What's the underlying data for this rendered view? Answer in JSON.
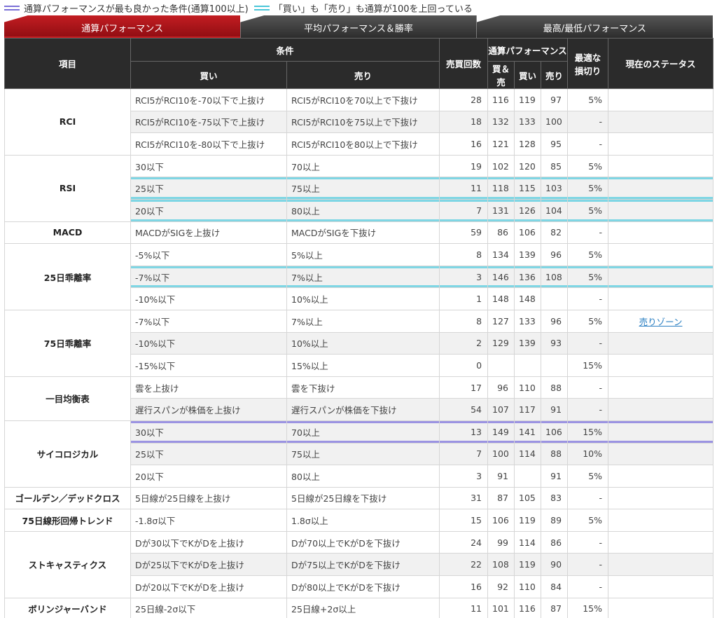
{
  "legend": {
    "purple_text": "通算パフォーマンスが最も良かった条件(通算100以上)",
    "cyan_text": "「買い」も「売り」も通算が100を上回っている"
  },
  "tabs": [
    "通算パフォーマンス",
    "平均パフォーマンス＆勝率",
    "最高/最低パフォーマンス"
  ],
  "headers": {
    "item": "項目",
    "condition": "条件",
    "buy": "買い",
    "sell": "売り",
    "trades": "売買回数",
    "perf": "通算パフォーマンス",
    "perf_both": "買＆売",
    "perf_buy": "買い",
    "perf_sell": "売り",
    "stoploss_1": "最適な",
    "stoploss_2": "損切り",
    "status": "現在のステータス"
  },
  "groups": [
    {
      "name": "RCI",
      "rows": [
        {
          "buy": "RCI5がRCI10を-70以下で上抜け",
          "sell": "RCI5がRCI10を70以上で下抜け",
          "trades": "28",
          "both": "116",
          "pbuy": "119",
          "psell": "97",
          "stop": "5%",
          "status": ""
        },
        {
          "buy": "RCI5がRCI10を-75以下で上抜け",
          "sell": "RCI5がRCI10を75以上で下抜け",
          "trades": "18",
          "both": "132",
          "pbuy": "133",
          "psell": "100",
          "stop": "-",
          "status": ""
        },
        {
          "buy": "RCI5がRCI10を-80以下で上抜け",
          "sell": "RCI5がRCI10を80以上で下抜け",
          "trades": "16",
          "both": "121",
          "pbuy": "128",
          "psell": "95",
          "stop": "-",
          "status": ""
        }
      ]
    },
    {
      "name": "RSI",
      "rows": [
        {
          "buy": "30以下",
          "sell": "70以上",
          "trades": "19",
          "both": "102",
          "pbuy": "120",
          "psell": "85",
          "stop": "5%",
          "status": ""
        },
        {
          "buy": "25以下",
          "sell": "75以上",
          "trades": "11",
          "both": "118",
          "pbuy": "115",
          "psell": "103",
          "stop": "5%",
          "status": ""
        },
        {
          "buy": "20以下",
          "sell": "80以上",
          "trades": "7",
          "both": "131",
          "pbuy": "126",
          "psell": "104",
          "stop": "5%",
          "status": ""
        }
      ]
    },
    {
      "name": "MACD",
      "rows": [
        {
          "buy": "MACDがSIGを上抜け",
          "sell": "MACDがSIGを下抜け",
          "trades": "59",
          "both": "86",
          "pbuy": "106",
          "psell": "82",
          "stop": "-",
          "status": ""
        }
      ]
    },
    {
      "name": "25日乖離率",
      "rows": [
        {
          "buy": "-5%以下",
          "sell": "5%以上",
          "trades": "8",
          "both": "134",
          "pbuy": "139",
          "psell": "96",
          "stop": "5%",
          "status": ""
        },
        {
          "buy": "-7%以下",
          "sell": "7%以上",
          "trades": "3",
          "both": "146",
          "pbuy": "136",
          "psell": "108",
          "stop": "5%",
          "status": ""
        },
        {
          "buy": "-10%以下",
          "sell": "10%以上",
          "trades": "1",
          "both": "148",
          "pbuy": "148",
          "psell": "",
          "stop": "-",
          "status": ""
        }
      ]
    },
    {
      "name": "75日乖離率",
      "rows": [
        {
          "buy": "-7%以下",
          "sell": "7%以上",
          "trades": "8",
          "both": "127",
          "pbuy": "133",
          "psell": "96",
          "stop": "5%",
          "status": "売りゾーン"
        },
        {
          "buy": "-10%以下",
          "sell": "10%以上",
          "trades": "2",
          "both": "129",
          "pbuy": "139",
          "psell": "93",
          "stop": "-",
          "status": ""
        },
        {
          "buy": "-15%以下",
          "sell": "15%以上",
          "trades": "0",
          "both": "",
          "pbuy": "",
          "psell": "",
          "stop": "15%",
          "status": ""
        }
      ]
    },
    {
      "name": "一目均衡表",
      "rows": [
        {
          "buy": "雲を上抜け",
          "sell": "雲を下抜け",
          "trades": "17",
          "both": "96",
          "pbuy": "110",
          "psell": "88",
          "stop": "-",
          "status": ""
        },
        {
          "buy": "遅行スパンが株価を上抜け",
          "sell": "遅行スパンが株価を下抜け",
          "trades": "54",
          "both": "107",
          "pbuy": "117",
          "psell": "91",
          "stop": "-",
          "status": ""
        }
      ]
    },
    {
      "name": "サイコロジカル",
      "rows": [
        {
          "buy": "30以下",
          "sell": "70以上",
          "trades": "13",
          "both": "149",
          "pbuy": "141",
          "psell": "106",
          "stop": "15%",
          "status": ""
        },
        {
          "buy": "25以下",
          "sell": "75以上",
          "trades": "7",
          "both": "100",
          "pbuy": "114",
          "psell": "88",
          "stop": "10%",
          "status": ""
        },
        {
          "buy": "20以下",
          "sell": "80以上",
          "trades": "3",
          "both": "91",
          "pbuy": "",
          "psell": "91",
          "stop": "5%",
          "status": ""
        }
      ]
    },
    {
      "name": "ゴールデン／デッドクロス",
      "rows": [
        {
          "buy": "5日線が25日線を上抜け",
          "sell": "5日線が25日線を下抜け",
          "trades": "31",
          "both": "87",
          "pbuy": "105",
          "psell": "83",
          "stop": "-",
          "status": ""
        }
      ]
    },
    {
      "name": "75日線形回帰トレンド",
      "rows": [
        {
          "buy": "-1.8σ以下",
          "sell": "1.8σ以上",
          "trades": "15",
          "both": "106",
          "pbuy": "119",
          "psell": "89",
          "stop": "5%",
          "status": ""
        }
      ]
    },
    {
      "name": "ストキャスティクス",
      "rows": [
        {
          "buy": "Dが30以下でKがDを上抜け",
          "sell": "Dが70以上でKがDを下抜け",
          "trades": "24",
          "both": "99",
          "pbuy": "114",
          "psell": "86",
          "stop": "-",
          "status": ""
        },
        {
          "buy": "Dが25以下でKがDを上抜け",
          "sell": "Dが75以上でKがDを下抜け",
          "trades": "22",
          "both": "108",
          "pbuy": "119",
          "psell": "90",
          "stop": "-",
          "status": ""
        },
        {
          "buy": "Dが20以下でKがDを上抜け",
          "sell": "Dが80以上でKがDを下抜け",
          "trades": "16",
          "both": "92",
          "pbuy": "110",
          "psell": "84",
          "stop": "-",
          "status": ""
        }
      ]
    },
    {
      "name": "ボリンジャーバンド",
      "rows": [
        {
          "buy": "25日線-2σ以下",
          "sell": "25日線+2σ以上",
          "trades": "11",
          "both": "101",
          "pbuy": "116",
          "psell": "87",
          "stop": "15%",
          "status": ""
        }
      ]
    }
  ]
}
